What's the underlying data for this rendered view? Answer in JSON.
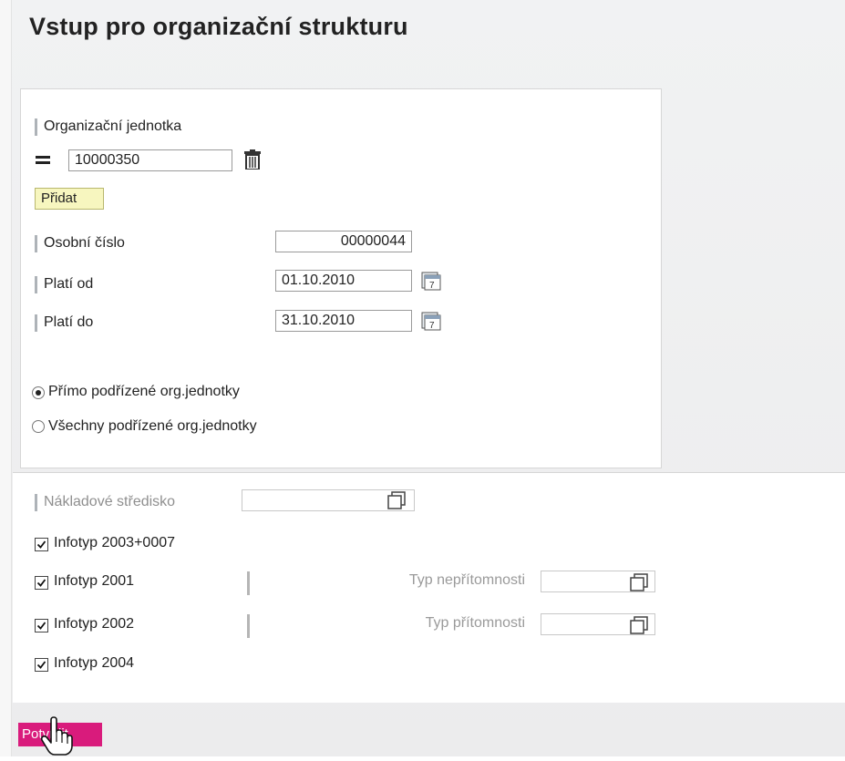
{
  "page": {
    "title": "Vstup pro organizační strukturu"
  },
  "org_section": {
    "org_unit_label": "Organizační jednotka",
    "org_unit_value": "10000350",
    "add_button": "Přidat",
    "personal_number_label": "Osobní číslo",
    "personal_number_value": "00000044",
    "valid_from_label": "Platí od",
    "valid_from_value": "01.10.2010",
    "valid_to_label": "Platí do",
    "valid_to_value": "31.10.2010",
    "radio_direct": {
      "label": "Přímo podřízené org.jednotky",
      "selected": true
    },
    "radio_all": {
      "label": "Všechny podřízené org.jednotky",
      "selected": false
    }
  },
  "filter_section": {
    "cost_center_label": "Nákladové středisko",
    "cost_center_value": "",
    "infotypes": [
      {
        "label": "Infotyp 2003+0007",
        "checked": true
      },
      {
        "label": "Infotyp 2001",
        "checked": true
      },
      {
        "label": "Infotyp 2002",
        "checked": true
      },
      {
        "label": "Infotyp 2004",
        "checked": true
      }
    ],
    "absence_type_label": "Typ nepřítomnosti",
    "absence_type_value": "",
    "attendance_type_label": "Typ přítomnosti",
    "attendance_type_value": ""
  },
  "footer": {
    "confirm_button": "Potvrdit"
  },
  "icons": [
    "equals-icon",
    "trash-icon",
    "calendar-icon",
    "value-help-icon",
    "hand-cursor-icon"
  ],
  "colors": {
    "confirm_button": "#d91b7c",
    "add_button_bg": "#f7f6bf"
  }
}
